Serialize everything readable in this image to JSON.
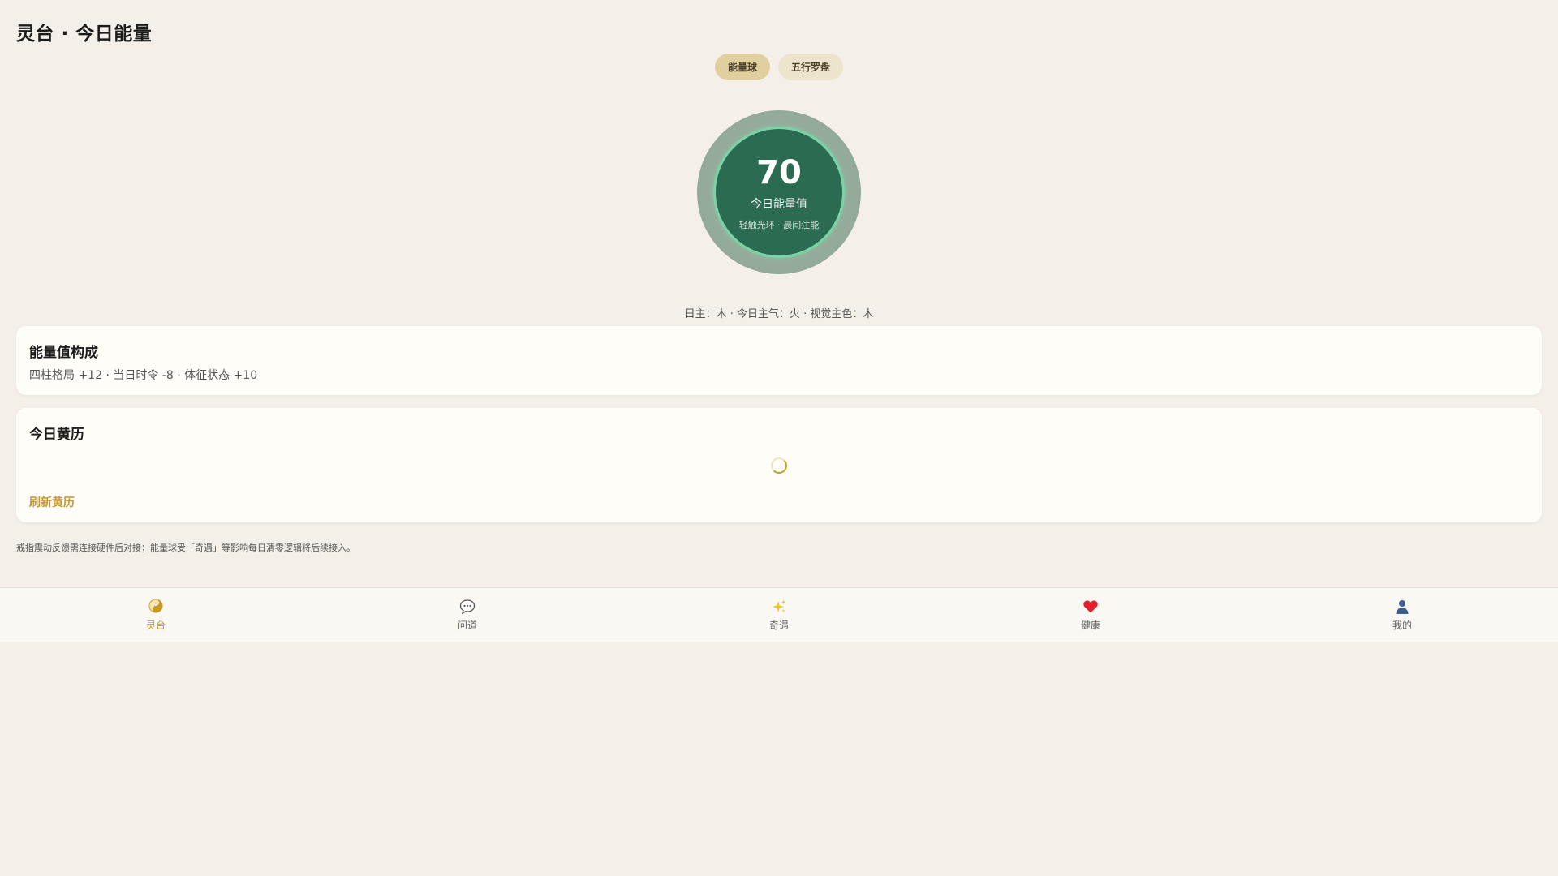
{
  "header": {
    "title": "灵台 · 今日能量"
  },
  "mode_toggle": {
    "options": [
      "能量球",
      "五行罗盘"
    ],
    "selected": "能量球"
  },
  "orb": {
    "value": "70",
    "label": "今日能量值",
    "hint": "轻触光环 · 晨间注能",
    "colors": {
      "halo": "#93aa99",
      "core": "#2a6b52",
      "ring": "#7dd3a8"
    }
  },
  "summary": "日主：木 · 今日主气：火 · 视觉主色：木",
  "composition": {
    "title": "能量值构成",
    "text": "四柱格局 +12 · 当日时令 -8 · 体征状态 +10"
  },
  "almanac": {
    "title": "今日黄历",
    "loading": true,
    "refresh_label": "刷新黄历"
  },
  "footnote": "戒指震动反馈需连接硬件后对接；能量球受「奇遇」等影响每日清零逻辑将后续接入。",
  "tabbar": {
    "active": "灵台",
    "items": [
      {
        "label": "灵台",
        "icon": "yin-yang-icon"
      },
      {
        "label": "问道",
        "icon": "speech-bubble-icon"
      },
      {
        "label": "奇遇",
        "icon": "sparkles-icon"
      },
      {
        "label": "健康",
        "icon": "heart-icon"
      },
      {
        "label": "我的",
        "icon": "person-icon"
      }
    ]
  },
  "colors": {
    "background": "#f4f0e9",
    "accent": "#c59a26",
    "pill_active": "#e0d09f",
    "pill_inactive": "#ede4cc"
  }
}
